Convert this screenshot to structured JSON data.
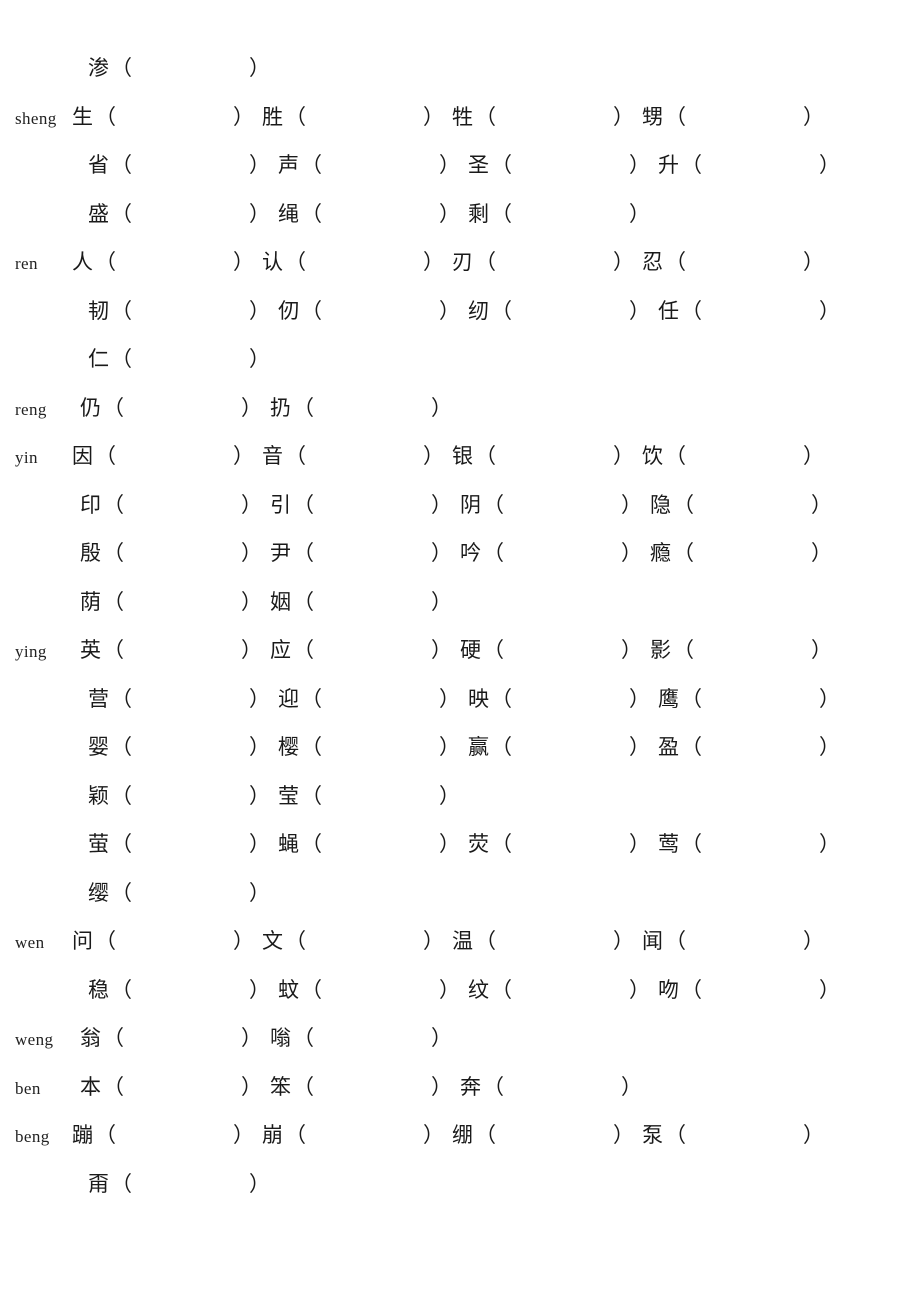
{
  "document": {
    "type": "chinese-pinyin-character-worksheet",
    "paren_open": "（",
    "paren_close": "）"
  },
  "rows": [
    {
      "pinyin": "",
      "indent": 2,
      "cells": [
        {
          "hanzi": "渗"
        }
      ]
    },
    {
      "pinyin": "sheng",
      "indent": 0,
      "cells": [
        {
          "hanzi": "生"
        },
        {
          "hanzi": "胜"
        },
        {
          "hanzi": "牲"
        },
        {
          "hanzi": "甥"
        }
      ]
    },
    {
      "pinyin": "",
      "indent": 2,
      "cells": [
        {
          "hanzi": "省"
        },
        {
          "hanzi": "声"
        },
        {
          "hanzi": "圣"
        },
        {
          "hanzi": "升"
        }
      ]
    },
    {
      "pinyin": "",
      "indent": 2,
      "cells": [
        {
          "hanzi": "盛"
        },
        {
          "hanzi": "绳"
        },
        {
          "hanzi": "剩"
        }
      ]
    },
    {
      "pinyin": "ren",
      "indent": 0,
      "cells": [
        {
          "hanzi": "人"
        },
        {
          "hanzi": "认"
        },
        {
          "hanzi": "刃"
        },
        {
          "hanzi": "忍"
        }
      ]
    },
    {
      "pinyin": "",
      "indent": 2,
      "cells": [
        {
          "hanzi": "韧"
        },
        {
          "hanzi": "仞"
        },
        {
          "hanzi": "纫"
        },
        {
          "hanzi": "任"
        }
      ]
    },
    {
      "pinyin": "",
      "indent": 2,
      "cells": [
        {
          "hanzi": "仁"
        }
      ]
    },
    {
      "pinyin": "reng",
      "indent": 1,
      "cells": [
        {
          "hanzi": "仍"
        },
        {
          "hanzi": "扔"
        }
      ]
    },
    {
      "pinyin": "yin",
      "indent": 0,
      "cells": [
        {
          "hanzi": "因"
        },
        {
          "hanzi": "音"
        },
        {
          "hanzi": "银"
        },
        {
          "hanzi": "饮"
        }
      ]
    },
    {
      "pinyin": "",
      "indent": 1,
      "cells": [
        {
          "hanzi": "印"
        },
        {
          "hanzi": "引"
        },
        {
          "hanzi": "阴"
        },
        {
          "hanzi": "隐"
        }
      ]
    },
    {
      "pinyin": "",
      "indent": 1,
      "cells": [
        {
          "hanzi": "殷"
        },
        {
          "hanzi": "尹"
        },
        {
          "hanzi": "吟"
        },
        {
          "hanzi": "瘾"
        }
      ]
    },
    {
      "pinyin": "",
      "indent": 1,
      "cells": [
        {
          "hanzi": "荫"
        },
        {
          "hanzi": "姻"
        }
      ]
    },
    {
      "pinyin": "ying",
      "indent": 1,
      "cells": [
        {
          "hanzi": "英"
        },
        {
          "hanzi": "应"
        },
        {
          "hanzi": "硬"
        },
        {
          "hanzi": "影"
        }
      ]
    },
    {
      "pinyin": "",
      "indent": 2,
      "cells": [
        {
          "hanzi": "营"
        },
        {
          "hanzi": "迎"
        },
        {
          "hanzi": "映"
        },
        {
          "hanzi": "鹰"
        }
      ]
    },
    {
      "pinyin": "",
      "indent": 2,
      "cells": [
        {
          "hanzi": "婴"
        },
        {
          "hanzi": "樱"
        },
        {
          "hanzi": "赢"
        },
        {
          "hanzi": "盈"
        }
      ]
    },
    {
      "pinyin": "",
      "indent": 2,
      "cells": [
        {
          "hanzi": "颖"
        },
        {
          "hanzi": "莹"
        }
      ]
    },
    {
      "pinyin": "",
      "indent": 2,
      "cells": [
        {
          "hanzi": "萤"
        },
        {
          "hanzi": "蝇"
        },
        {
          "hanzi": "荧"
        },
        {
          "hanzi": "莺"
        }
      ]
    },
    {
      "pinyin": "",
      "indent": 2,
      "cells": [
        {
          "hanzi": "缨"
        }
      ]
    },
    {
      "pinyin": "wen",
      "indent": 0,
      "cells": [
        {
          "hanzi": "问"
        },
        {
          "hanzi": "文"
        },
        {
          "hanzi": "温"
        },
        {
          "hanzi": "闻"
        }
      ]
    },
    {
      "pinyin": "",
      "indent": 2,
      "cells": [
        {
          "hanzi": "稳"
        },
        {
          "hanzi": "蚊"
        },
        {
          "hanzi": "纹"
        },
        {
          "hanzi": "吻"
        }
      ]
    },
    {
      "pinyin": "weng",
      "indent": 1,
      "cells": [
        {
          "hanzi": "翁"
        },
        {
          "hanzi": "嗡"
        }
      ]
    },
    {
      "pinyin": "ben",
      "indent": 1,
      "cells": [
        {
          "hanzi": "本"
        },
        {
          "hanzi": "笨"
        },
        {
          "hanzi": "奔"
        }
      ]
    },
    {
      "pinyin": "beng",
      "indent": 0,
      "cells": [
        {
          "hanzi": "蹦"
        },
        {
          "hanzi": "崩"
        },
        {
          "hanzi": "绷"
        },
        {
          "hanzi": "泵"
        }
      ]
    },
    {
      "pinyin": "",
      "indent": 2,
      "cells": [
        {
          "hanzi": "甭"
        }
      ]
    }
  ]
}
